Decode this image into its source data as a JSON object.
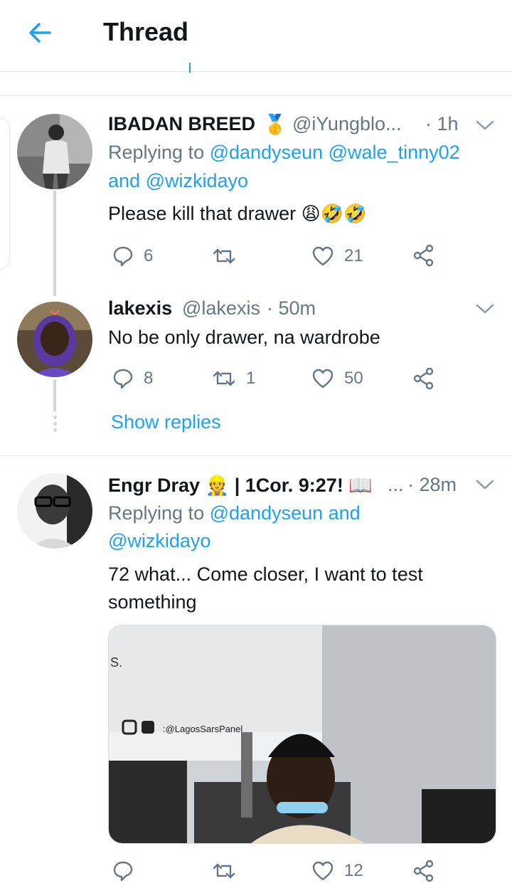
{
  "header": {
    "title": "Thread"
  },
  "tweets": [
    {
      "name": "IBADAN BREED",
      "badge": "🥇",
      "handle": "@iYungblo...",
      "time": "· 1h",
      "replying_prefix": "Replying to",
      "replying_users": "@dandyseun @wale_tinny02",
      "replying_and": "and",
      "replying_last": "@wizkidayo",
      "text": "Please kill that drawer",
      "emojis": "😩🤣🤣",
      "reply_count": "6",
      "retweet_count": "",
      "like_count": "21"
    },
    {
      "name": "lakexis",
      "handle": "@lakexis",
      "time": "· 50m",
      "text": "No be only drawer, na wardrobe",
      "reply_count": "8",
      "retweet_count": "1",
      "like_count": "50"
    },
    {
      "name": "Engr Dray",
      "name_emoji": "👷",
      "name_extra": "| 1Cor. 9:27!",
      "name_extra_emoji": "📖",
      "ellipsis": "...",
      "time": "· 28m",
      "replying_prefix": "Replying to",
      "replying_users": "@dandyseun and",
      "replying_last": "@wizkidayo",
      "text": "72 what... Come closer, I want to test something",
      "media": {
        "sign_text": "S.",
        "watermark": ":@LagosSarsPanel"
      },
      "reply_count": "",
      "retweet_count": "",
      "like_count": "12"
    }
  ],
  "show_replies": "Show replies",
  "colors": {
    "accent": "#1da1f2",
    "secondary_text": "#657786",
    "divider": "#e1e8ed"
  }
}
